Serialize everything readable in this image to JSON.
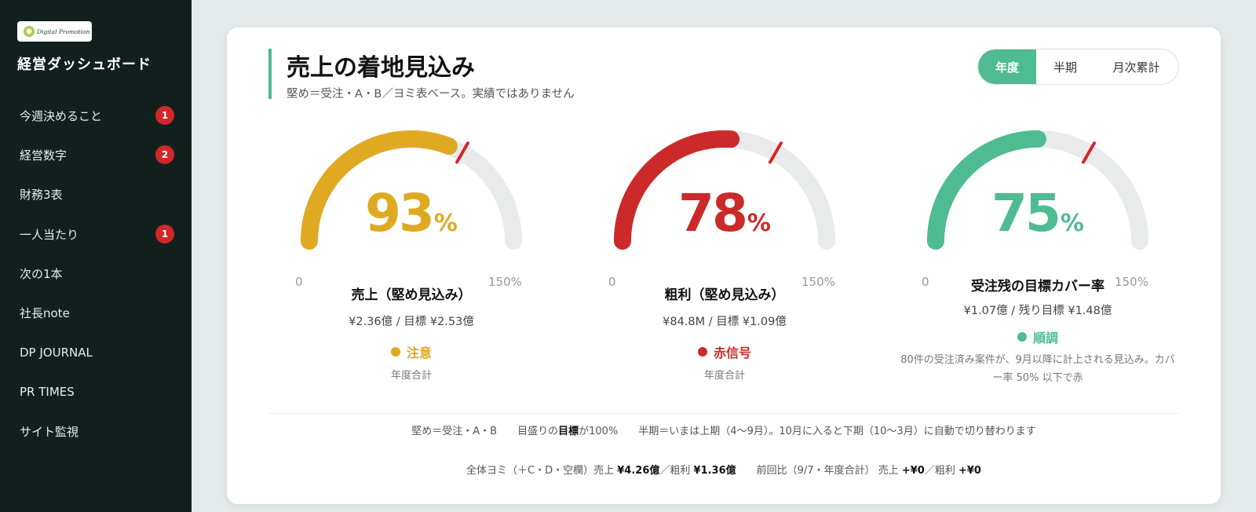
{
  "sidebar": {
    "logo_text": "Digital Promotion",
    "title": "経営ダッシュボード",
    "items": [
      {
        "label": "今週決めること",
        "badge": "1"
      },
      {
        "label": "経営数字",
        "badge": "2"
      },
      {
        "label": "財務3表",
        "badge": ""
      },
      {
        "label": "一人当たり",
        "badge": "1"
      },
      {
        "label": "次の1本",
        "badge": ""
      },
      {
        "label": "社長note",
        "badge": ""
      },
      {
        "label": "DP JOURNAL",
        "badge": ""
      },
      {
        "label": "PR TIMES",
        "badge": ""
      },
      {
        "label": "サイト監視",
        "badge": ""
      }
    ]
  },
  "main": {
    "title": "売上の着地見込み",
    "subtitle": "堅め＝受注・A・B／ヨミ表ベース。実績ではありません",
    "period_toggle": {
      "options": [
        "年度",
        "半期",
        "月次累計"
      ],
      "selected": "年度"
    }
  },
  "gauges": [
    {
      "value": "93",
      "unit": "%",
      "fraction": 0.62,
      "min": "0",
      "max": "150%",
      "label": "売上（堅め見込み）",
      "detail": "¥2.36億 / 目標 ¥2.53億",
      "status": "注意",
      "status_color": "#e0a922",
      "note": "年度合計"
    },
    {
      "value": "78",
      "unit": "%",
      "fraction": 0.52,
      "min": "0",
      "max": "150%",
      "label": "粗利（堅め見込み）",
      "detail": "¥84.8M / 目標 ¥1.09億",
      "status": "赤信号",
      "status_color": "#cc2a2a",
      "note": "年度合計"
    },
    {
      "value": "75",
      "unit": "%",
      "fraction": 0.5,
      "min": "0",
      "max": "150%",
      "label": "受注残の目標カバー率",
      "detail": "¥1.07億 / 残り目標 ¥1.48億",
      "status": "順調",
      "status_color": "#4fbb93",
      "note_line1": "80件の受注済み案件が、9月以降に計上される見込み。カバ",
      "note_line2": "ー率 50% 以下で赤"
    }
  ],
  "colors": {
    "target_marker": "#d1262b",
    "track": "#e8ebea",
    "accent": "#4fbb93"
  },
  "footer": {
    "line1": {
      "firm": "堅め＝受注・A・B",
      "target_pre": "目盛りの",
      "target_bold": "目標",
      "target_post": "が100%",
      "period": "半期＝いまは上期（4〜9月）。10月に入ると下期（10〜3月）に自動で切り替わります"
    },
    "line2": {
      "all_pre": "全体ヨミ（＋C・D・空欄）売上 ",
      "all_sales": "¥4.26億",
      "all_mid": "／粗利 ",
      "all_gross": "¥1.36億",
      "prev_pre": "前回比（9/7・年度合計） 売上 ",
      "prev_sales": "+¥0",
      "prev_mid": "／粗利 ",
      "prev_gross": "+¥0"
    }
  }
}
